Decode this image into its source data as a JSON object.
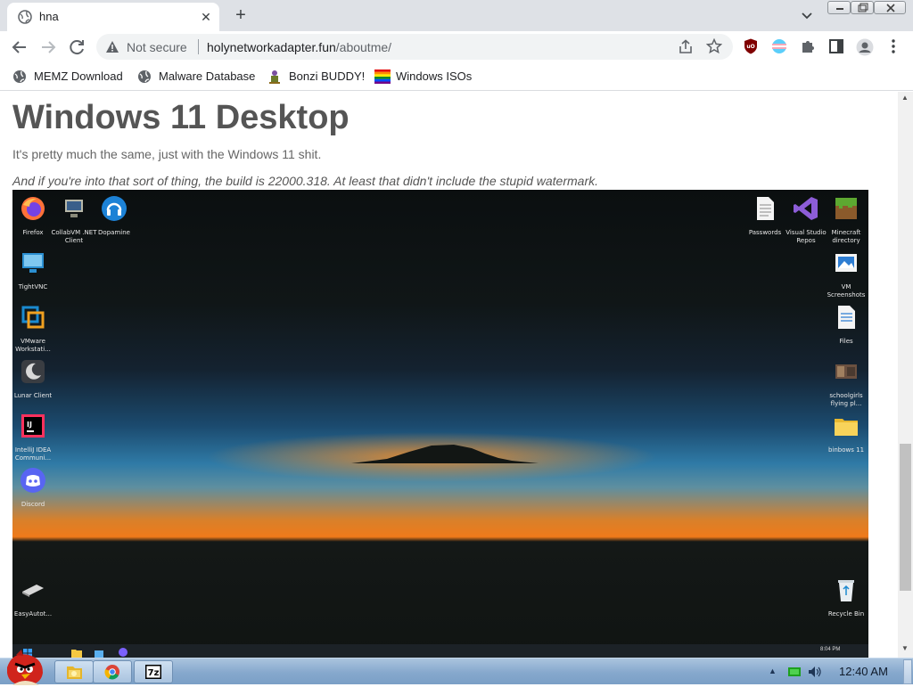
{
  "browser": {
    "tab": {
      "title": "hna",
      "close_glyph": "✕"
    },
    "new_tab_glyph": "+",
    "security_text": "Not secure",
    "url_domain": "holynetworkadapter.fun",
    "url_path": "/aboutme/",
    "bookmarks": [
      {
        "label": "MEMZ Download",
        "icon": "globe-icon"
      },
      {
        "label": "Malware Database",
        "icon": "globe-icon"
      },
      {
        "label": "Bonzi BUDDY!",
        "icon": "bonzi-icon"
      },
      {
        "label": "Windows ISOs",
        "icon": "rainbow-flag-icon"
      }
    ],
    "extensions": [
      "ublock-icon",
      "extension-pride-icon",
      "puzzle-icon",
      "sidepanel-icon",
      "profile-icon",
      "menu-icon"
    ]
  },
  "page": {
    "title": "Windows 11 Desktop",
    "paragraph": "It's pretty much the same, just with the Windows 11 shit.",
    "note": "And if you're into that sort of thing, the build is 22000.318. At least that didn't include the stupid watermark."
  },
  "screenshot": {
    "left_icons": [
      {
        "label": "Firefox",
        "icon": "firefox-icon"
      },
      {
        "label": "CollabVM .NET Client",
        "icon": "collabvm-icon"
      },
      {
        "label": "Dopamine",
        "icon": "dopamine-icon"
      },
      {
        "label": "TightVNC",
        "icon": "tightvnc-icon"
      },
      {
        "label": "VMware Workstati...",
        "icon": "vmware-icon"
      },
      {
        "label": "Lunar Client",
        "icon": "lunar-client-icon"
      },
      {
        "label": "IntelliJ IDEA Communi...",
        "icon": "intellij-icon"
      },
      {
        "label": "Discord",
        "icon": "discord-icon"
      },
      {
        "label": "EasyAutot...",
        "icon": "easyautotagger-icon"
      }
    ],
    "right_icons": [
      {
        "label": "Passwords",
        "icon": "text-file-icon"
      },
      {
        "label": "Visual Studio Repos",
        "icon": "visual-studio-icon"
      },
      {
        "label": "Minecraft directory",
        "icon": "minecraft-icon"
      },
      {
        "label": "VM Screenshots",
        "icon": "image-file-icon"
      },
      {
        "label": "Files",
        "icon": "document-icon"
      },
      {
        "label": "schoolgirls flying pl...",
        "icon": "thumbnail-icon"
      },
      {
        "label": "binbows 11",
        "icon": "folder-icon"
      },
      {
        "label": "Recycle Bin",
        "icon": "recycle-bin-icon"
      }
    ],
    "taskbar_time": "8:04 PM"
  },
  "os_taskbar": {
    "buttons": [
      "explorer-icon",
      "chrome-icon",
      "7zip-icon"
    ],
    "seven_zip_label": "7z",
    "clock": "12:40 AM"
  },
  "colors": {
    "chrome_frame": "#dee1e6",
    "omnibox": "#f1f3f4",
    "heading": "#555555",
    "os_taskbar": "#86a8cd"
  }
}
